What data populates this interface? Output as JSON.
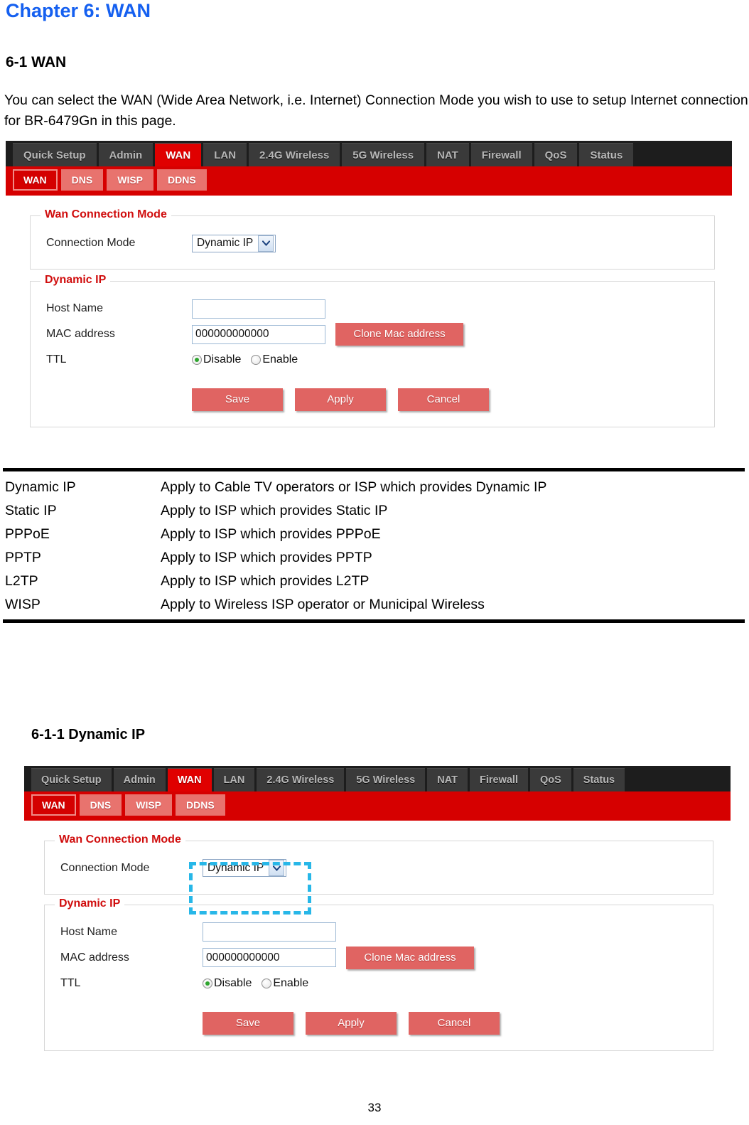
{
  "document": {
    "chapter_title": "Chapter 6: WAN",
    "section_title": "6-1 WAN",
    "intro_paragraph": "You can select the WAN (Wide Area Network, i.e. Internet) Connection Mode you wish to use to setup Internet connection for BR-6479Gn in this page.",
    "subsection_title": "6-1-1 Dynamic IP",
    "page_number": "33"
  },
  "mode_table": {
    "rows": [
      {
        "mode": "Dynamic IP",
        "description": "Apply to Cable TV operators or ISP which provides Dynamic IP"
      },
      {
        "mode": "Static IP",
        "description": "Apply to ISP which provides Static IP"
      },
      {
        "mode": "PPPoE",
        "description": "Apply to ISP which provides PPPoE"
      },
      {
        "mode": "PPTP",
        "description": "Apply to ISP which provides PPTP"
      },
      {
        "mode": "L2TP",
        "description": "Apply to ISP which provides L2TP"
      },
      {
        "mode": "WISP",
        "description": "Apply to Wireless ISP operator or Municipal Wireless"
      }
    ]
  },
  "router_ui": {
    "main_tabs": [
      {
        "label": "Quick Setup",
        "active": false
      },
      {
        "label": "Admin",
        "active": false
      },
      {
        "label": "WAN",
        "active": true
      },
      {
        "label": "LAN",
        "active": false
      },
      {
        "label": "2.4G Wireless",
        "active": false
      },
      {
        "label": "5G Wireless",
        "active": false
      },
      {
        "label": "NAT",
        "active": false
      },
      {
        "label": "Firewall",
        "active": false
      },
      {
        "label": "QoS",
        "active": false
      },
      {
        "label": "Status",
        "active": false
      }
    ],
    "sub_tabs": [
      {
        "label": "WAN",
        "active": true
      },
      {
        "label": "DNS",
        "active": false
      },
      {
        "label": "WISP",
        "active": false
      },
      {
        "label": "DDNS",
        "active": false
      }
    ],
    "wan_connection_mode": {
      "legend": "Wan Connection Mode",
      "connection_mode_label": "Connection Mode",
      "connection_mode_value": "Dynamic IP",
      "connection_mode_options": [
        "Dynamic IP",
        "Static IP",
        "PPPoE",
        "PPTP",
        "L2TP",
        "WISP"
      ]
    },
    "dynamic_ip": {
      "legend": "Dynamic IP",
      "host_name_label": "Host Name",
      "host_name_value": "",
      "host_name_placeholder": "",
      "mac_address_label": "MAC address",
      "mac_address_value": "000000000000",
      "clone_mac_label": "Clone Mac address",
      "ttl_label": "TTL",
      "ttl_disable_label": "Disable",
      "ttl_enable_label": "Enable",
      "ttl_selected": "Disable",
      "save_label": "Save",
      "apply_label": "Apply",
      "cancel_label": "Cancel"
    }
  },
  "colors": {
    "chapter_title": "#1560f0",
    "legend_red": "#d00d0d",
    "active_tab_red": "#e00000",
    "subnav_red": "#d60000",
    "button_red": "#e06462",
    "highlight_cyan": "#27b7e8",
    "nav_dark": "#1d1d1d",
    "radio_green": "#2fa52f"
  }
}
